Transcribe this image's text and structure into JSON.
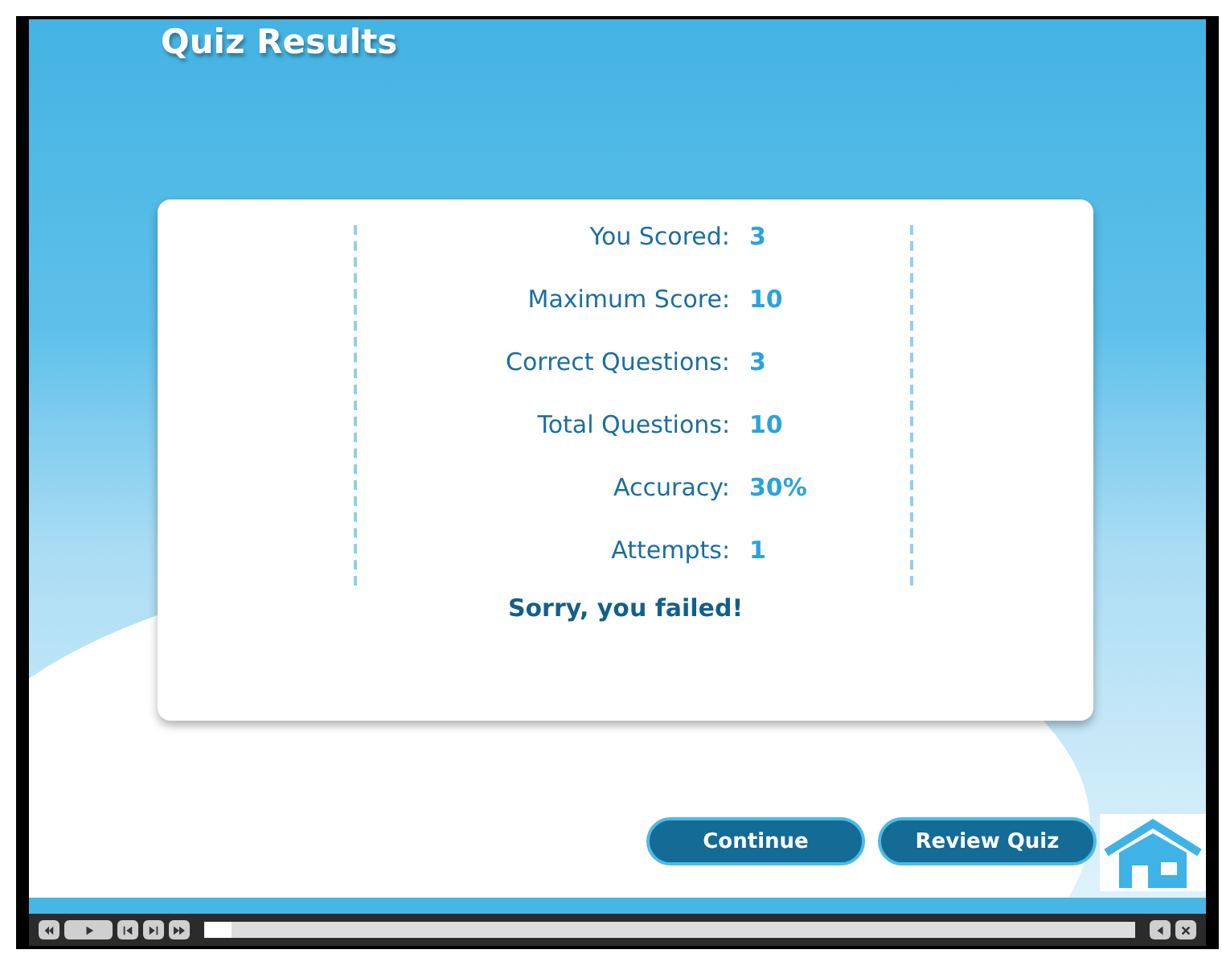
{
  "title": "Quiz Results",
  "results": [
    {
      "label": "You Scored:",
      "value": "3"
    },
    {
      "label": "Maximum Score:",
      "value": "10"
    },
    {
      "label": "Correct Questions:",
      "value": "3"
    },
    {
      "label": "Total Questions:",
      "value": "10"
    },
    {
      "label": "Accuracy:",
      "value": "30%"
    },
    {
      "label": "Attempts:",
      "value": "1"
    }
  ],
  "message": "Sorry, you failed!",
  "buttons": [
    "Continue",
    "Review Quiz"
  ],
  "player": {
    "progress": {
      "level": 0.03
    }
  }
}
